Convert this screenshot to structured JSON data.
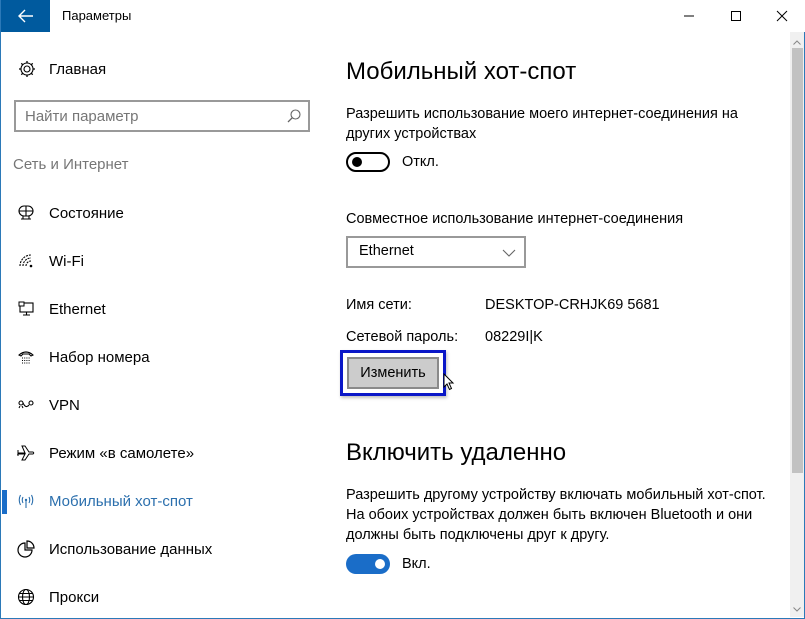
{
  "window": {
    "title": "Параметры",
    "controls": [
      "minimize",
      "maximize",
      "close"
    ]
  },
  "sidebar": {
    "home_label": "Главная",
    "search_placeholder": "Найти параметр",
    "section_label": "Сеть и Интернет",
    "items": [
      {
        "label": "Состояние",
        "icon": "globe-monitor-icon",
        "active": false
      },
      {
        "label": "Wi-Fi",
        "icon": "wifi-icon",
        "active": false
      },
      {
        "label": "Ethernet",
        "icon": "ethernet-icon",
        "active": false
      },
      {
        "label": "Набор номера",
        "icon": "phone-icon",
        "active": false
      },
      {
        "label": "VPN",
        "icon": "vpn-icon",
        "active": false
      },
      {
        "label": "Режим «в самолете»",
        "icon": "airplane-icon",
        "active": false
      },
      {
        "label": "Мобильный хот-спот",
        "icon": "hotspot-icon",
        "active": true
      },
      {
        "label": "Использование данных",
        "icon": "pie-chart-icon",
        "active": false
      },
      {
        "label": "Прокси",
        "icon": "globe-icon",
        "active": false
      }
    ]
  },
  "content": {
    "hotspot": {
      "title": "Мобильный хот-спот",
      "description": "Разрешить использование моего интернет-соединения на других устройствах",
      "toggle_state": "off",
      "toggle_label": "Откл."
    },
    "sharing": {
      "label": "Совместное использование интернет-соединения",
      "selected": "Ethernet"
    },
    "network": {
      "name_key": "Имя сети:",
      "name_value": "DESKTOP-CRHJK69 5681",
      "password_key": "Сетевой пароль:",
      "password_value": "08229I|K",
      "change_button": "Изменить"
    },
    "remote": {
      "title": "Включить удаленно",
      "description": "Разрешить другому устройству включать мобильный хот-спот. На обоих устройствах должен быть включен Bluetooth и они должны быть подключены друг к другу.",
      "toggle_state": "on",
      "toggle_label": "Вкл."
    }
  },
  "colors": {
    "accent": "#1a6dc8",
    "back_button": "#005a9e",
    "active_text": "#2b6fad",
    "highlight_border": "#0a17c8"
  }
}
